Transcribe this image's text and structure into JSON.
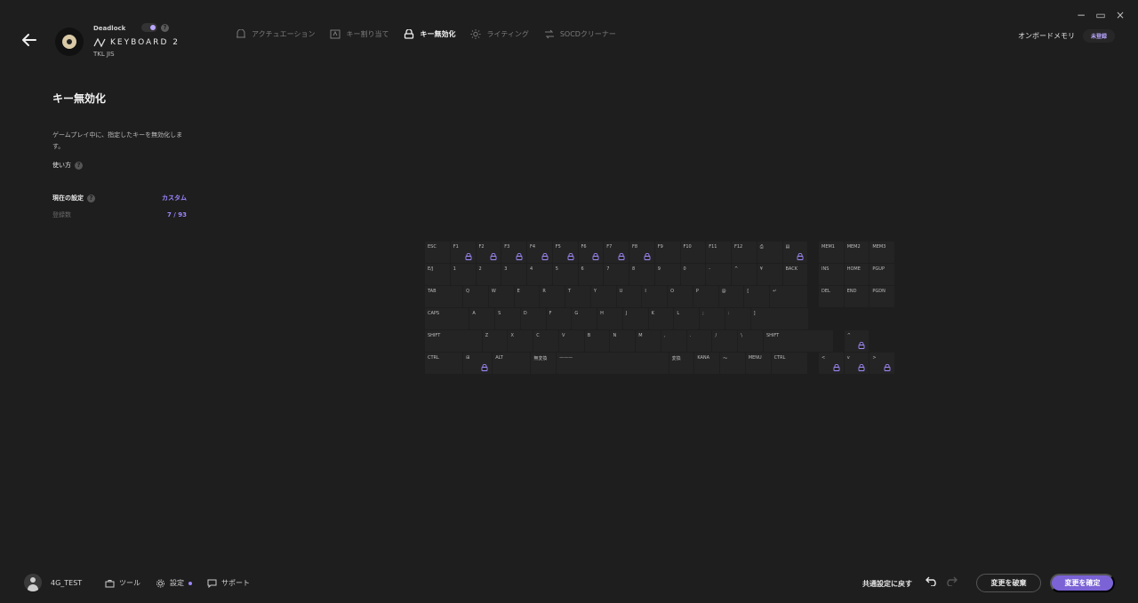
{
  "window": {
    "minimize": "−",
    "maximize": "▭",
    "close": "×"
  },
  "device": {
    "name": "Deadlock",
    "brand": "KEYBOARD 2",
    "layout": "TKL JIS"
  },
  "tabs": [
    {
      "label": "アクチュエーション",
      "icon": "actuation-icon",
      "active": false
    },
    {
      "label": "キー割り当て",
      "icon": "assign-icon",
      "active": false
    },
    {
      "label": "キー無効化",
      "icon": "lock-icon",
      "active": true
    },
    {
      "label": "ライティング",
      "icon": "sun-icon",
      "active": false
    },
    {
      "label": "SOCDクリーナー",
      "icon": "socd-icon",
      "active": false
    }
  ],
  "onboard": {
    "label": "オンボードメモリ",
    "status": "未登録"
  },
  "panel": {
    "title": "キー無効化",
    "description": "ゲームプレイ中に、指定したキーを無効化します。",
    "howto": "使い方",
    "current_label": "現在の設定",
    "current_value": "カスタム",
    "count_label": "登録数",
    "count_value": "7 / 93"
  },
  "keyboard": {
    "rows": [
      [
        {
          "l": "ESC"
        },
        {
          "l": "F1",
          "lock": true
        },
        {
          "l": "F2",
          "lock": true
        },
        {
          "l": "F3",
          "lock": true
        },
        {
          "l": "F4",
          "lock": true
        },
        {
          "l": "F5",
          "lock": true
        },
        {
          "l": "F6",
          "lock": true
        },
        {
          "l": "F7",
          "lock": true
        },
        {
          "l": "F8",
          "lock": true
        },
        {
          "l": "F9"
        },
        {
          "l": "F10"
        },
        {
          "l": "F11"
        },
        {
          "l": "F12"
        },
        {
          "l": "⎙"
        },
        {
          "l": "▤",
          "lock": true
        }
      ],
      [
        {
          "l": "E/J"
        },
        {
          "l": "1"
        },
        {
          "l": "2"
        },
        {
          "l": "3"
        },
        {
          "l": "4"
        },
        {
          "l": "5"
        },
        {
          "l": "6"
        },
        {
          "l": "7"
        },
        {
          "l": "8"
        },
        {
          "l": "9"
        },
        {
          "l": "0"
        },
        {
          "l": "-"
        },
        {
          "l": "^"
        },
        {
          "l": "¥"
        },
        {
          "l": "BACK"
        }
      ],
      [
        {
          "l": "TAB"
        },
        {
          "l": "Q"
        },
        {
          "l": "W"
        },
        {
          "l": "E"
        },
        {
          "l": "R"
        },
        {
          "l": "T"
        },
        {
          "l": "Y"
        },
        {
          "l": "U"
        },
        {
          "l": "I"
        },
        {
          "l": "O"
        },
        {
          "l": "P"
        },
        {
          "l": "@"
        },
        {
          "l": "["
        },
        {
          "l": "↵"
        }
      ],
      [
        {
          "l": "CAPS"
        },
        {
          "l": "A"
        },
        {
          "l": "S"
        },
        {
          "l": "D"
        },
        {
          "l": "F"
        },
        {
          "l": "G"
        },
        {
          "l": "H"
        },
        {
          "l": "J"
        },
        {
          "l": "K"
        },
        {
          "l": "L"
        },
        {
          "l": ";"
        },
        {
          "l": ":"
        },
        {
          "l": "]"
        }
      ],
      [
        {
          "l": "SHIFT"
        },
        {
          "l": "Z"
        },
        {
          "l": "X"
        },
        {
          "l": "C"
        },
        {
          "l": "V"
        },
        {
          "l": "B"
        },
        {
          "l": "N"
        },
        {
          "l": "M"
        },
        {
          "l": ","
        },
        {
          "l": "."
        },
        {
          "l": "/"
        },
        {
          "l": "\\"
        },
        {
          "l": "SHIFT"
        }
      ],
      [
        {
          "l": "CTRL"
        },
        {
          "l": "⊞",
          "lock": true
        },
        {
          "l": "ALT"
        },
        {
          "l": "無変換"
        },
        {
          "l": "———"
        },
        {
          "l": "変換"
        },
        {
          "l": "KANA"
        },
        {
          "l": "〜"
        },
        {
          "l": "MENU"
        },
        {
          "l": "CTRL"
        }
      ]
    ],
    "nav": [
      {
        "l": "MEM1"
      },
      {
        "l": "MEM2"
      },
      {
        "l": "MEM3"
      },
      {
        "l": "INS"
      },
      {
        "l": "HOME"
      },
      {
        "l": "PGUP"
      },
      {
        "l": "DEL"
      },
      {
        "l": "END"
      },
      {
        "l": "PGDN"
      },
      {
        "l": "^",
        "lock": true
      },
      {
        "l": "<",
        "lock": true
      },
      {
        "l": "v",
        "lock": true
      },
      {
        "l": ">",
        "lock": true
      }
    ]
  },
  "footer": {
    "user": "4G_TEST",
    "tools": "ツール",
    "settings": "設定",
    "support": "サポート",
    "reset": "共通設定に戻す",
    "discard": "変更を破棄",
    "confirm": "変更を確定"
  },
  "colors": {
    "accent": "#9c85ff",
    "button": "#7b63d6",
    "background": "#1e1e1e",
    "key": "#242424"
  }
}
